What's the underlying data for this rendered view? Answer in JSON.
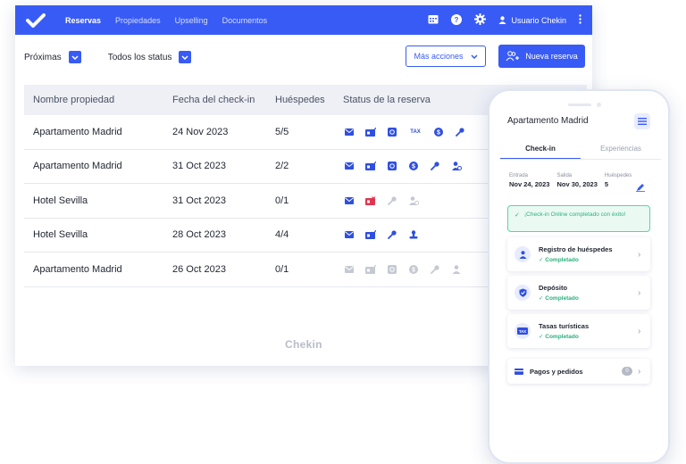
{
  "colors": {
    "brand": "#385bf5",
    "success": "#2bb07e",
    "muted": "#b4b9c5"
  },
  "nav": {
    "items": [
      "Reservas",
      "Propiedades",
      "Upselling",
      "Documentos"
    ],
    "active": 0
  },
  "user": {
    "name": "Usuario Chekin"
  },
  "filters": {
    "upcoming": "Próximas",
    "status": "Todos los status"
  },
  "actions": {
    "more": "Más acciones",
    "new_booking": "Nueva reserva"
  },
  "table": {
    "headers": [
      "Nombre propiedad",
      "Fecha del check-in",
      "Huéspedes",
      "Status de la reserva"
    ],
    "rows": [
      {
        "property": "Apartamento Madrid",
        "date": "24 Nov 2023",
        "guests": "5/5"
      },
      {
        "property": "Apartamento Madrid",
        "date": "31 Oct 2023",
        "guests": "2/2"
      },
      {
        "property": "Hotel Sevilla",
        "date": "31 Oct 2023",
        "guests": "0/1"
      },
      {
        "property": "Hotel Sevilla",
        "date": "28 Oct 2023",
        "guests": "4/4"
      },
      {
        "property": "Apartamento Madrid",
        "date": "26 Oct 2023",
        "guests": "0/1"
      }
    ],
    "tax_label": "TAX"
  },
  "brand_footer": "Chekin",
  "phone": {
    "title": "Apartamento Madrid",
    "tabs": [
      "Check-in",
      "Experiencias"
    ],
    "dates": {
      "entry_label": "Entrada",
      "entry_value": "Nov 24, 2023",
      "exit_label": "Salida",
      "exit_value": "Nov 30, 2023",
      "guests_label": "Huéspedes",
      "guests_value": "5"
    },
    "success_message": "¡Check-in Online completado con éxito!",
    "cards": [
      {
        "title": "Registro de huéspedes",
        "status": "Completado"
      },
      {
        "title": "Depósito",
        "status": "Completado"
      },
      {
        "title": "Tasas turísticas",
        "status": "Completado"
      }
    ],
    "payments": {
      "title": "Pagos y pedidos",
      "count": "0"
    }
  }
}
